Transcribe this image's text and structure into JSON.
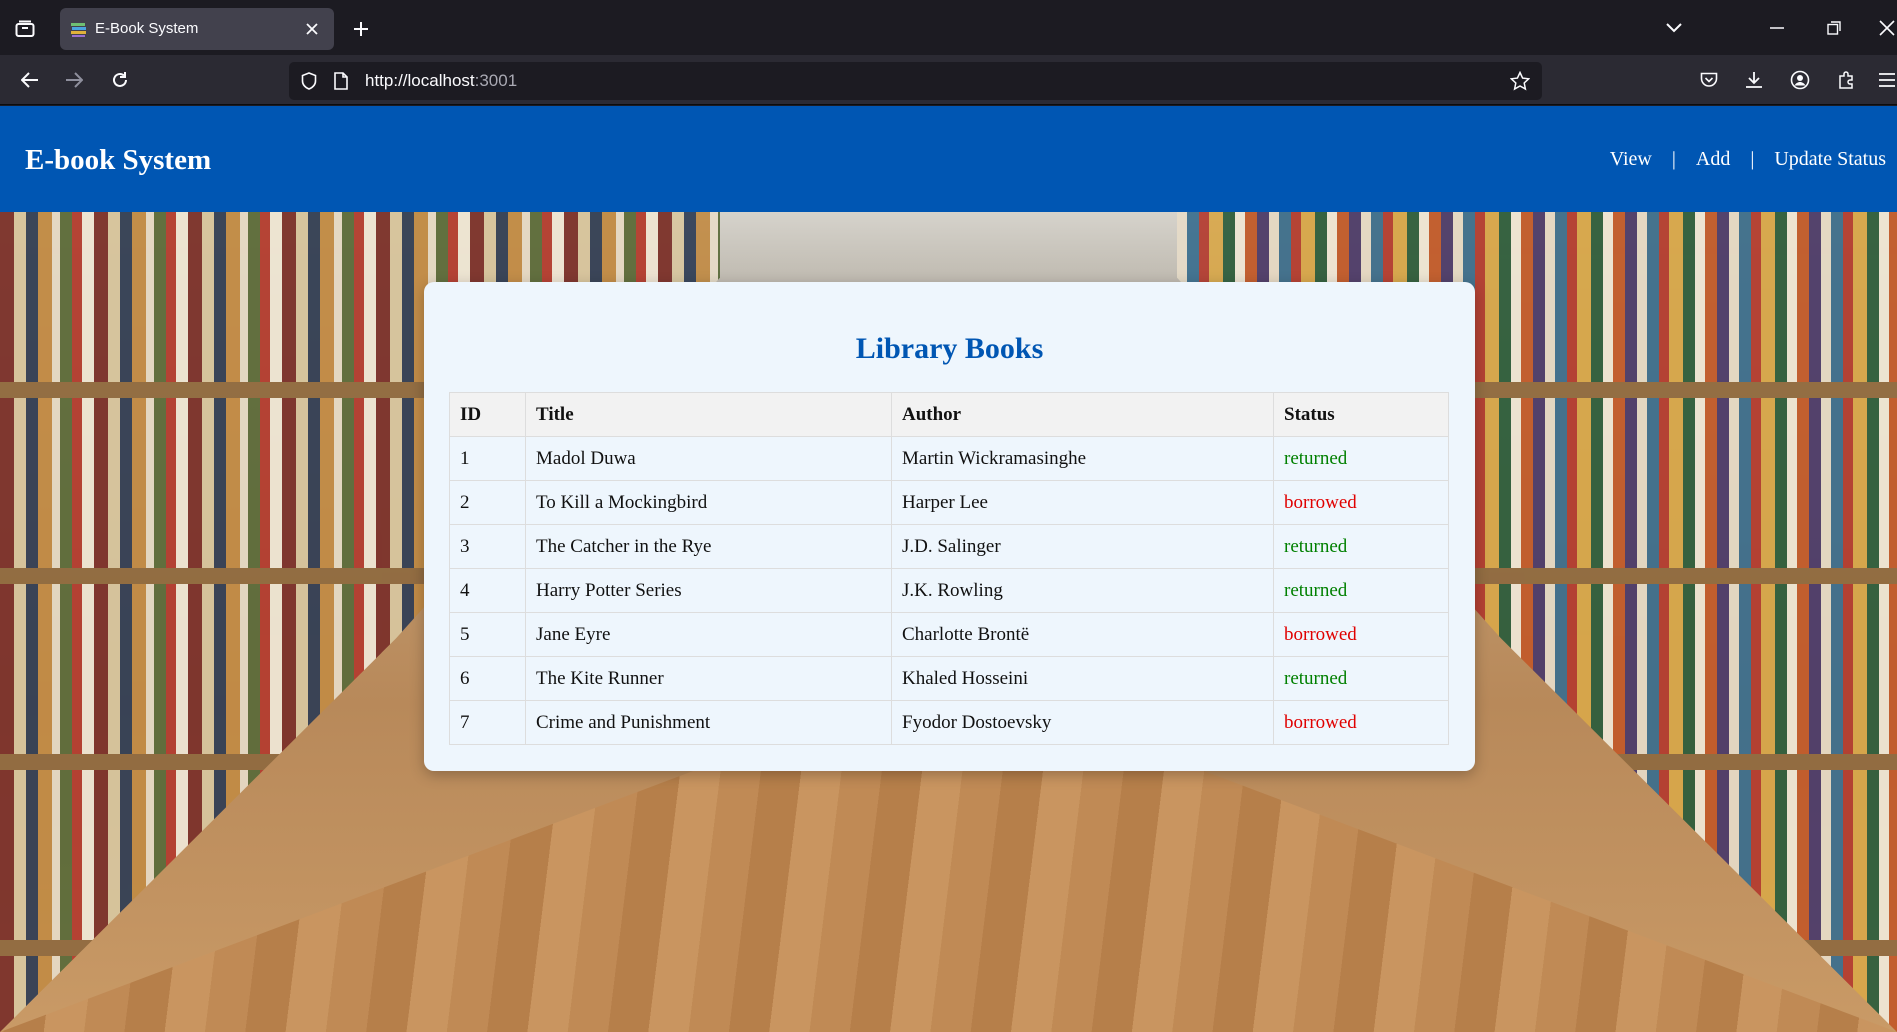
{
  "browser": {
    "tab": {
      "title": "E-Book System"
    },
    "url": {
      "host": "http://localhost",
      "port": ":3001"
    }
  },
  "navbar": {
    "brand": "E-book System",
    "links": [
      {
        "label": "View"
      },
      {
        "label": "Add"
      },
      {
        "label": "Update Status"
      }
    ],
    "separator": "|"
  },
  "card": {
    "title": "Library Books",
    "columns": [
      "ID",
      "Title",
      "Author",
      "Status"
    ],
    "rows": [
      {
        "id": "1",
        "title": "Madol Duwa",
        "author": "Martin Wickramasinghe",
        "status": "returned"
      },
      {
        "id": "2",
        "title": "To Kill a Mockingbird",
        "author": "Harper Lee",
        "status": "borrowed"
      },
      {
        "id": "3",
        "title": "The Catcher in the Rye",
        "author": "J.D. Salinger",
        "status": "returned"
      },
      {
        "id": "4",
        "title": "Harry Potter Series",
        "author": "J.K. Rowling",
        "status": "returned"
      },
      {
        "id": "5",
        "title": "Jane Eyre",
        "author": "Charlotte Brontë",
        "status": "borrowed"
      },
      {
        "id": "6",
        "title": "The Kite Runner",
        "author": "Khaled Hosseini",
        "status": "returned"
      },
      {
        "id": "7",
        "title": "Crime and Punishment",
        "author": "Fyodor Dostoevsky",
        "status": "borrowed"
      }
    ]
  },
  "colors": {
    "navbar": "#0056b3",
    "title": "#0056b3",
    "returned": "#008000",
    "borrowed": "#e00000"
  },
  "icons": [
    "tab-list-icon",
    "book-favicon-icon",
    "close-icon",
    "new-tab-icon",
    "list-all-tabs-icon",
    "minimize-icon",
    "restore-icon",
    "window-close-icon",
    "back-icon",
    "forward-icon",
    "reload-icon",
    "shield-icon",
    "page-icon",
    "bookmark-star-icon",
    "pocket-icon",
    "download-icon",
    "account-icon",
    "extensions-icon",
    "menu-icon"
  ]
}
